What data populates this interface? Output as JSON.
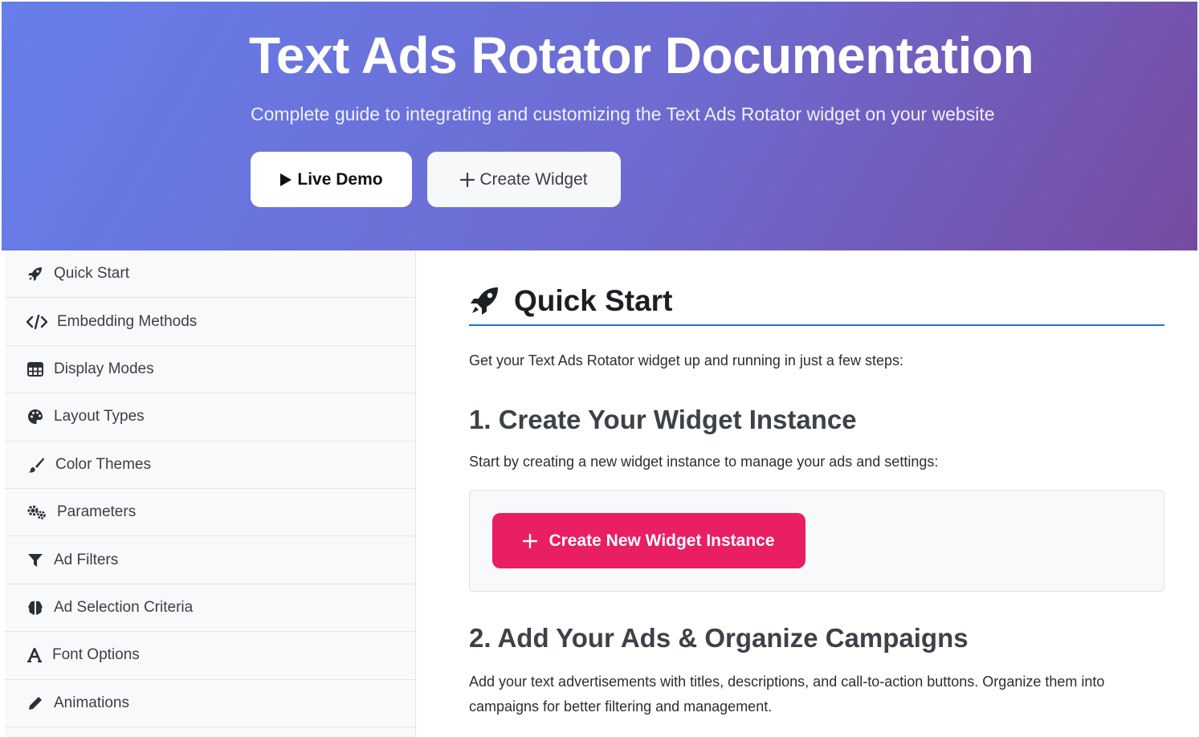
{
  "hero": {
    "title": "Text Ads Rotator Documentation",
    "subtitle": "Complete guide to integrating and customizing the Text Ads Rotator widget on your website",
    "live_demo_label": "Live Demo",
    "create_widget_label": "Create Widget"
  },
  "sidebar": {
    "items": [
      {
        "label": "Quick Start",
        "icon": "rocket-icon"
      },
      {
        "label": "Embedding Methods",
        "icon": "code-icon"
      },
      {
        "label": "Display Modes",
        "icon": "table-icon"
      },
      {
        "label": "Layout Types",
        "icon": "palette-icon"
      },
      {
        "label": "Color Themes",
        "icon": "paintbrush-icon"
      },
      {
        "label": "Parameters",
        "icon": "gears-icon"
      },
      {
        "label": "Ad Filters",
        "icon": "filter-icon"
      },
      {
        "label": "Ad Selection Criteria",
        "icon": "brain-icon"
      },
      {
        "label": "Font Options",
        "icon": "font-icon"
      },
      {
        "label": "Animations",
        "icon": "pen-icon"
      }
    ]
  },
  "main": {
    "section_title": "Quick Start",
    "intro": "Get your Text Ads Rotator widget up and running in just a few steps:",
    "step1_title": "1. Create Your Widget Instance",
    "step1_text": "Start by creating a new widget instance to manage your ads and settings:",
    "create_instance_label": "Create New Widget Instance",
    "step2_title": "2. Add Your Ads & Organize Campaigns",
    "step2_text": "Add your text advertisements with titles, descriptions, and call-to-action buttons. Organize them into campaigns for better filtering and management."
  },
  "colors": {
    "hero_gradient_start": "#667eea",
    "hero_gradient_end": "#764ba2",
    "accent_pink": "#e91e63",
    "heading_underline": "#1976d2"
  }
}
